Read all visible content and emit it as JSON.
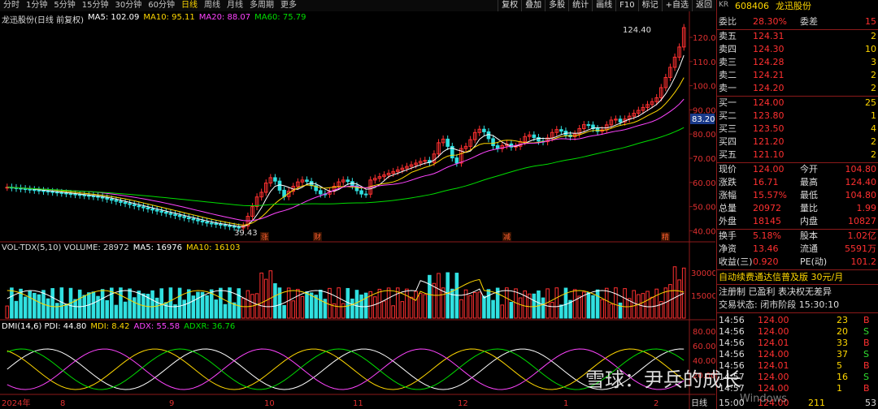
{
  "toolbar": {
    "tabs": [
      "分时",
      "1分钟",
      "5分钟",
      "15分钟",
      "30分钟",
      "60分钟",
      "日线",
      "周线",
      "月线",
      "多周期",
      "更多"
    ],
    "active": "日线",
    "buttons": [
      "复权",
      "叠加",
      "多股",
      "统计",
      "画线",
      "F10",
      "标记",
      "+自选",
      "返回"
    ]
  },
  "main": {
    "title": "龙迅股份(日线 前复权)",
    "ma": [
      {
        "label": "MA5: 102.09",
        "color": "#ffffff"
      },
      {
        "label": "MA10: 95.11",
        "color": "#ffd700"
      },
      {
        "label": "MA20: 88.07",
        "color": "#ff44ff"
      },
      {
        "label": "MA60: 75.79",
        "color": "#00dd00"
      }
    ],
    "yaxis": [
      "120.0",
      "110.0",
      "100.0",
      "90.00",
      "80.00",
      "70.00",
      "60.00",
      "50.00",
      "40.00"
    ],
    "high_label": "124.40",
    "low_label": "39.43",
    "price_tag": "83.20",
    "event_marks": [
      "涨",
      "财",
      "减",
      "精"
    ]
  },
  "volume": {
    "legend": [
      {
        "label": "VOL-TDX(5,10) VOLUME: 28972",
        "color": "#dddddd"
      },
      {
        "label": "MA5: 16976",
        "color": "#ffffff"
      },
      {
        "label": "MA10: 16103",
        "color": "#ffd700"
      }
    ],
    "yaxis": [
      "30000",
      "15000"
    ]
  },
  "dmi": {
    "legend": [
      {
        "label": "DMI(14,6) PDI: 44.80",
        "color": "#ffffff"
      },
      {
        "label": "MDI: 8.42",
        "color": "#ffd700"
      },
      {
        "label": "ADX: 55.58",
        "color": "#ff44ff"
      },
      {
        "label": "ADXR: 36.76",
        "color": "#00dd00"
      }
    ],
    "yaxis": [
      "80.00",
      "60.00",
      "40.00",
      "20.00"
    ]
  },
  "xaxis": {
    "labels": [
      "2024年",
      "8",
      "9",
      "10",
      "11",
      "12",
      "1",
      "2"
    ],
    "end_label": "日线"
  },
  "panel": {
    "tag": "KR",
    "code": "608406",
    "name": "龙迅股份",
    "wei": {
      "l1": "委比",
      "v1": "28.30%",
      "l2": "委差",
      "v2": "15"
    },
    "sell": [
      {
        "label": "卖五",
        "price": "124.31",
        "vol": "2"
      },
      {
        "label": "卖四",
        "price": "124.30",
        "vol": "10"
      },
      {
        "label": "卖三",
        "price": "124.28",
        "vol": "3"
      },
      {
        "label": "卖二",
        "price": "124.21",
        "vol": "2"
      },
      {
        "label": "卖一",
        "price": "124.20",
        "vol": "2"
      }
    ],
    "buy": [
      {
        "label": "买一",
        "price": "124.00",
        "vol": "25"
      },
      {
        "label": "买二",
        "price": "123.80",
        "vol": "1"
      },
      {
        "label": "买三",
        "price": "123.50",
        "vol": "4"
      },
      {
        "label": "买四",
        "price": "121.20",
        "vol": "2"
      },
      {
        "label": "买五",
        "price": "121.10",
        "vol": "2"
      }
    ],
    "stats": [
      {
        "l1": "现价",
        "v1": "124.00",
        "l2": "今开",
        "v2": "104.80"
      },
      {
        "l1": "涨跌",
        "v1": "16.71",
        "l2": "最高",
        "v2": "124.40"
      },
      {
        "l1": "涨幅",
        "v1": "15.57%",
        "l2": "最低",
        "v2": "104.80"
      },
      {
        "l1": "总量",
        "v1": "20972",
        "l2": "量比",
        "v2": "1.99"
      },
      {
        "l1": "外盘",
        "v1": "18145",
        "l2": "内盘",
        "v2": "10827"
      }
    ],
    "stats2": [
      {
        "l1": "换手",
        "v1": "5.18%",
        "l2": "股本",
        "v2": "1.02亿"
      },
      {
        "l1": "净资",
        "v1": "13.46",
        "l2": "流通",
        "v2": "5591万"
      },
      {
        "l1": "收益(三)",
        "v1": "0.920",
        "l2": "PE(动)",
        "v2": "101.2"
      }
    ],
    "promo": "自动续费通达信普及版 30元/月",
    "reg": "注册制 已盈利 表决权无差异",
    "status": "交易状态: 闭市阶段 15:30:10",
    "ticks": [
      {
        "t": "14:56",
        "p": "124.00",
        "v": "23",
        "s": "B"
      },
      {
        "t": "14:56",
        "p": "124.00",
        "v": "20",
        "s": "S"
      },
      {
        "t": "14:56",
        "p": "124.01",
        "v": "33",
        "s": "B"
      },
      {
        "t": "14:56",
        "p": "124.00",
        "v": "37",
        "s": "S"
      },
      {
        "t": "14:56",
        "p": "124.01",
        "v": "5",
        "s": "B"
      },
      {
        "t": "14:57",
        "p": "124.00",
        "v": "16",
        "s": "S"
      },
      {
        "t": "14:57",
        "p": "124.00",
        "v": "1",
        "s": "B"
      }
    ],
    "last": {
      "t": "15:00",
      "p": "124.00",
      "v": "211",
      "s": "53"
    }
  },
  "watermark": {
    "text": "雪球：尹兵的成长",
    "win": "Windows"
  },
  "colors": {
    "up": "#ff3030",
    "down": "#30e0e0",
    "frame": "#8b1a1a"
  }
}
